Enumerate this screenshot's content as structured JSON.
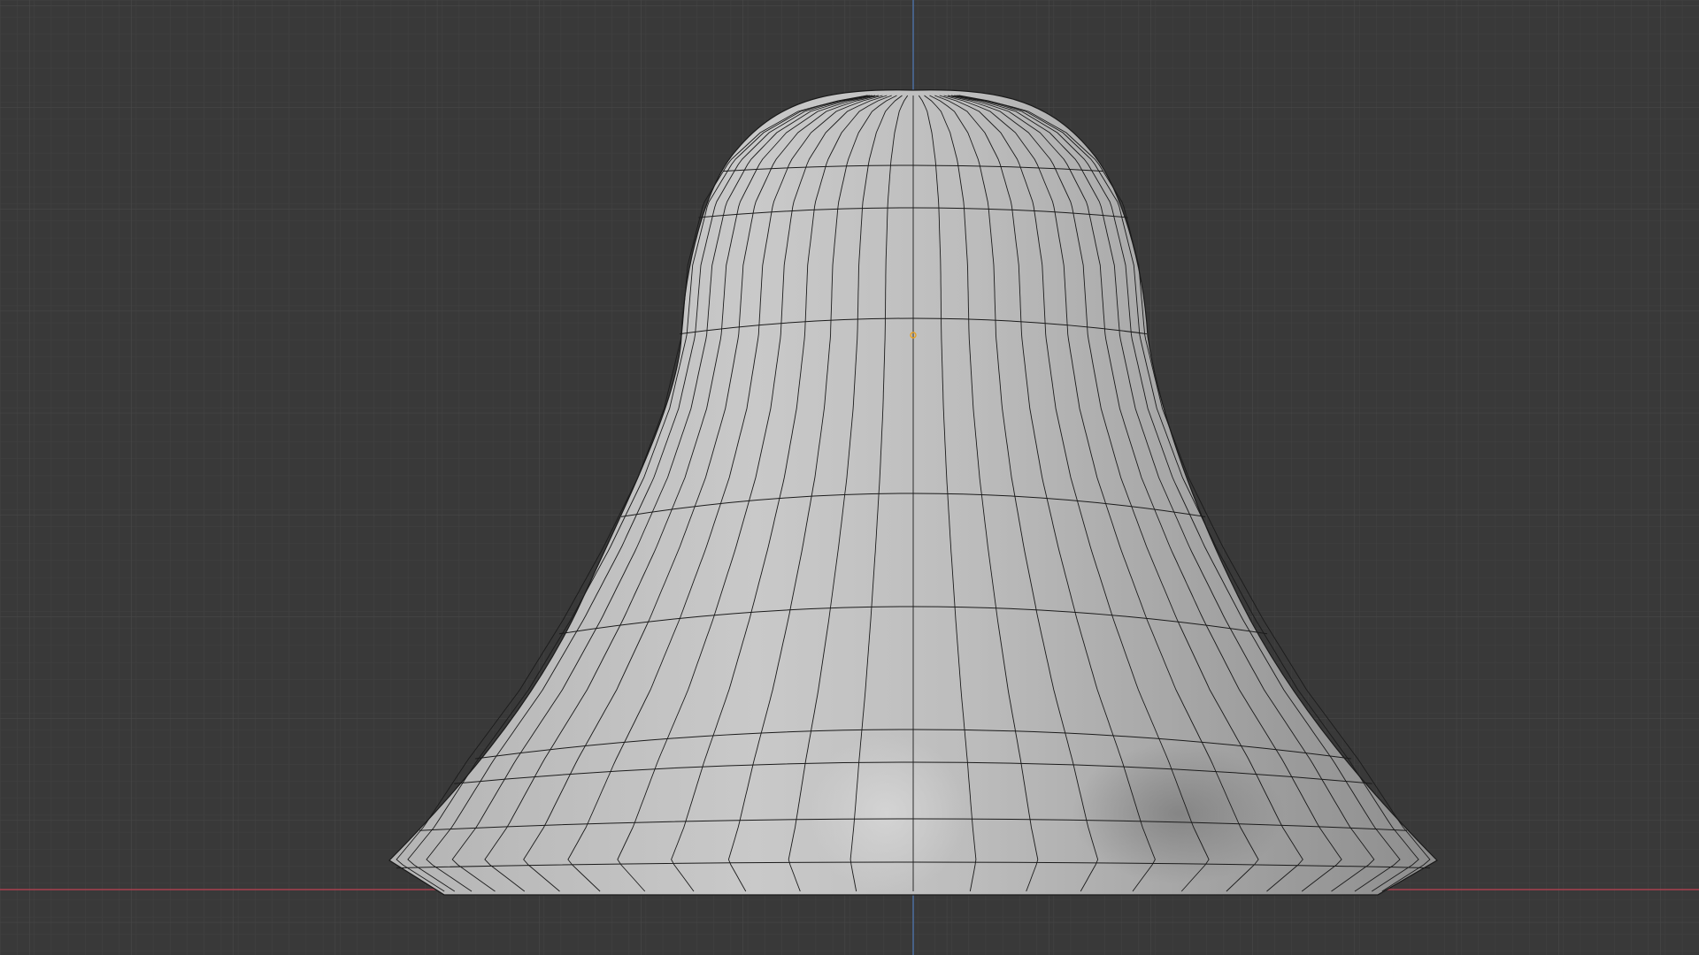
{
  "app": {
    "title": "",
    "view": "3D Viewport"
  },
  "scene": {
    "object_name": "",
    "shading": "solid",
    "overlay_wireframe": true,
    "object_origin_visible": true
  },
  "colors": {
    "background": "#393939",
    "grid_minor": "#414141",
    "grid_major": "#4a4a4a",
    "axis_x": "#a8414f",
    "axis_z": "#4c6f9f",
    "mesh_light": "#c6c6c6",
    "mesh_mid": "#a9a9a9",
    "mesh_dark": "#8a8a8a",
    "wire": "#1b1b1b",
    "origin": "#e8a020"
  }
}
